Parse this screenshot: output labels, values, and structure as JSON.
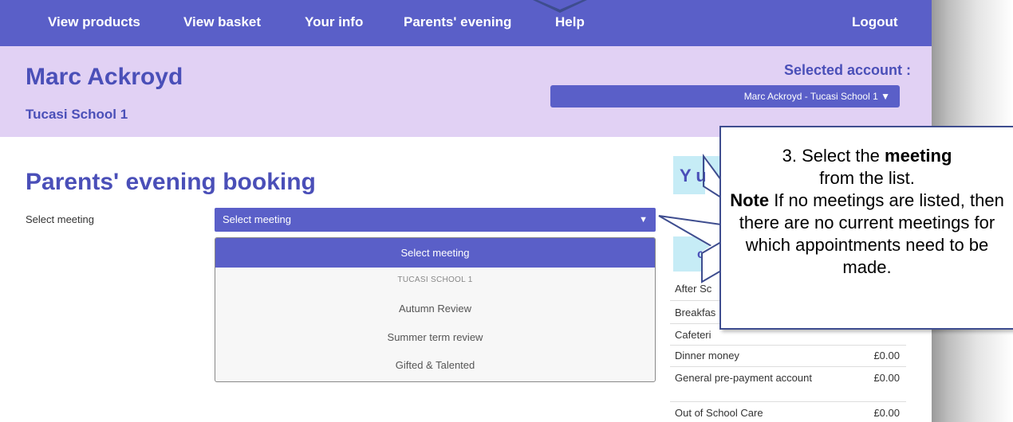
{
  "nav": {
    "items": [
      "View products",
      "View basket",
      "Your info",
      "Parents' evening",
      "Help"
    ],
    "logout": "Logout"
  },
  "header": {
    "user_name": "Marc Ackroyd",
    "school_name": "Tucasi School 1",
    "selected_account_label": "Selected account :",
    "selected_account_value": "Marc Ackroyd - Tucasi School 1",
    "dropdown_caret": "▼"
  },
  "main": {
    "title": "Parents' evening booking",
    "select_label": "Select meeting",
    "select_value": "Select meeting",
    "select_caret": "▼",
    "options": [
      {
        "label": "Select meeting",
        "type": "selected"
      },
      {
        "label": "TUCASI SCHOOL 1",
        "type": "group"
      },
      {
        "label": "Autumn Review",
        "type": "option"
      },
      {
        "label": "Summer term review",
        "type": "option"
      },
      {
        "label": "Gifted & Talented",
        "type": "option"
      }
    ]
  },
  "panel": {
    "heading_fragment": "Y ur",
    "subheading_fragment": "co",
    "balances": [
      {
        "name": "After Sc",
        "value": ""
      },
      {
        "name": "Breakfas",
        "value": ""
      },
      {
        "name": "Cafeteri",
        "value": ""
      },
      {
        "name": "Dinner money",
        "value": "£0.00"
      },
      {
        "name": "General pre-payment account",
        "value": "£0.00"
      },
      {
        "name": "Out of School Care",
        "value": "£0.00"
      }
    ]
  },
  "callout": {
    "line1_prefix": "3. Select the ",
    "line1_bold": "meeting",
    "line2": "from the list.",
    "note_bold": "Note",
    "note_rest": " If no meetings are listed, then there are no current meetings for which appointments need to be made."
  },
  "colors": {
    "nav": "#5a5fc8",
    "header_band": "#e1d1f4",
    "accent_text": "#4a4fb8",
    "panel_box": "#c6ecf6",
    "callout_border": "#3e4d8f"
  }
}
